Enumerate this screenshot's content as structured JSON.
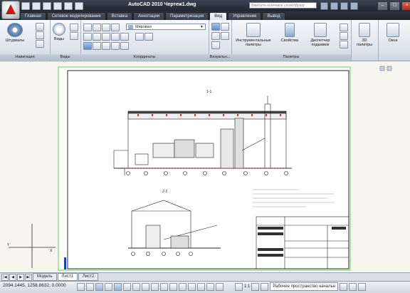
{
  "app": {
    "title": "AutoCAD 2010  Чертеж1.dwg",
    "search_placeholder": "Введите ключевое слово/фразу"
  },
  "tabs": [
    {
      "label": "Главная"
    },
    {
      "label": "Сетевое моделирование"
    },
    {
      "label": "Вставка"
    },
    {
      "label": "Аннотации"
    },
    {
      "label": "Параметризация"
    },
    {
      "label": "Вид"
    },
    {
      "label": "Управление"
    },
    {
      "label": "Вывод"
    }
  ],
  "active_tab": "Вид",
  "ribbon": {
    "navigation": {
      "title": "Навигация",
      "steeringwheels_label": "Штурвалы"
    },
    "views": {
      "title": "Виды",
      "views_label": "Виды"
    },
    "coordinates": {
      "title": "Координаты",
      "ucs_value": "Мировая"
    },
    "visual_styles": {
      "title": "Визуальн..."
    },
    "palettes": {
      "title": "Палитры",
      "tool_palettes_label": "Инструментальные палитры",
      "properties_label": "Свойства",
      "design_center_label": "Диспетчер подшивок"
    },
    "palettes_3d_label": "3D палитры",
    "windows_label": "Окна"
  },
  "layout_tabs": [
    {
      "label": "Модель"
    },
    {
      "label": "Лист1"
    },
    {
      "label": "Лист2"
    }
  ],
  "status": {
    "coordinates": "2094.1445, 1258.8632, 0.0000",
    "scale": "1:1",
    "workspace": "Рабочее пространство начальн"
  },
  "drawing": {
    "section_1_label": "1-1",
    "section_2_label": "2-2",
    "ucs_x": "X",
    "ucs_y": "Y"
  },
  "colors": {
    "accent": "#c8161d",
    "titlebar": "#2a323d",
    "drawing_bg": "#f7f6ee",
    "frame_green": "#58c85a"
  }
}
